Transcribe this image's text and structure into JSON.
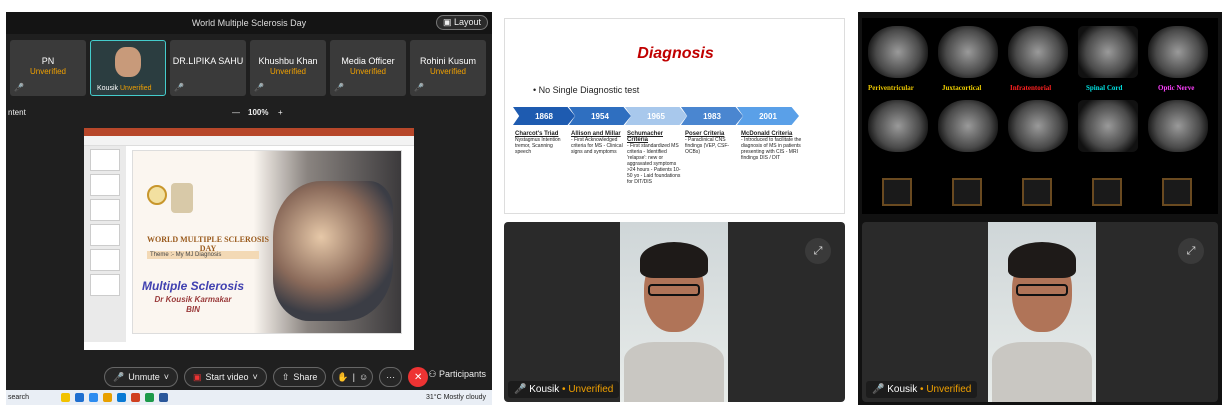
{
  "p1": {
    "title": "World Multiple Sclerosis Day",
    "layout": "Layout",
    "tiles": [
      {
        "name": "PN",
        "status": "Unverified"
      },
      {
        "name": "Kousik",
        "status": "Unverified"
      },
      {
        "name": "DR.LIPIKA SAHU",
        "status": ""
      },
      {
        "name": "Khushbu Khan",
        "status": "Unverified"
      },
      {
        "name": "Media Officer",
        "status": "Unverified"
      },
      {
        "name": "Rohini Kusum",
        "status": "Unverified"
      }
    ],
    "content": "ntent",
    "zoom": "100%",
    "zoom_minus": "—",
    "zoom_plus": "+",
    "slide": {
      "wmsd": "WORLD MULTIPLE SCLEROSIS DAY",
      "theme": "Theme :- My MJ Diagnosis",
      "title": "Multiple Sclerosis",
      "author": "Dr Kousik Karmakar",
      "org": "BIN"
    },
    "controls": {
      "unmute": "Unmute",
      "video": "Start video",
      "share": "Share",
      "leave": "✕",
      "participants": "Participants",
      "more": "···"
    },
    "taskbar": {
      "search": "search",
      "weather": "31°C  Mostly cloudy"
    }
  },
  "p2": {
    "title": "Diagnosis",
    "bullet": "•  No Single Diagnostic test",
    "years": [
      "1868",
      "1954",
      "1965",
      "1983",
      "2001"
    ],
    "cols": [
      {
        "h": "Charcot's Triad",
        "t": "Nystagmus Intention tremor, Scanning speech"
      },
      {
        "h": "Allison and Millar",
        "t": "- First Acknowledged criteria for MS - Clinical signs and symptoms"
      },
      {
        "h": "Schumacher Criteria",
        "t": "- First standardized MS criteria - Identified 'relapse': new or aggravated symptoms >24 hours - Patients 10-50 yo - Laid foundations for DIT/DIS"
      },
      {
        "h": "Poser Criteria",
        "t": "- Paraclinical CNS findings (VEP, CSF-OCBs)"
      },
      {
        "h": "McDonald Criteria",
        "t": "- Introduced to facilitate the diagnosis of MS in patients presenting with CIS - MRI findings DIS / DIT"
      }
    ],
    "name": "Kousik",
    "status": "Unverified"
  },
  "p3": {
    "labels": [
      {
        "t": "Periventricular",
        "c": "#e8c400"
      },
      {
        "t": "Juxtacortical",
        "c": "#f0d000"
      },
      {
        "t": "Infratentorial",
        "c": "#ff2020"
      },
      {
        "t": "Spinal Cord",
        "c": "#00e0e0"
      },
      {
        "t": "Optic Nerve",
        "c": "#ff40ff"
      }
    ],
    "name": "Kousik",
    "status": "Unverified"
  }
}
